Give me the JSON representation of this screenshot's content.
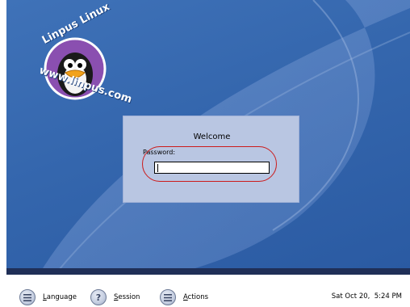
{
  "logo": {
    "top_text": "Linpus Linux",
    "bottom_text": "www.linpus.com"
  },
  "login": {
    "title": "Welcome",
    "password_label": "Password:",
    "password_value": ""
  },
  "taskbar": {
    "language": {
      "first": "L",
      "rest": "anguage",
      "icon": "menu-icon"
    },
    "session": {
      "first": "S",
      "rest": "ession",
      "icon": "help-icon"
    },
    "actions": {
      "first": "A",
      "rest": "ctions",
      "icon": "menu-icon"
    },
    "clock": "Sat Oct 20,  5:24 PM"
  },
  "colors": {
    "desktop_blue": "#3466ad",
    "dialog_bg": "#b9c6e2",
    "highlight": "#cc1b1b"
  }
}
